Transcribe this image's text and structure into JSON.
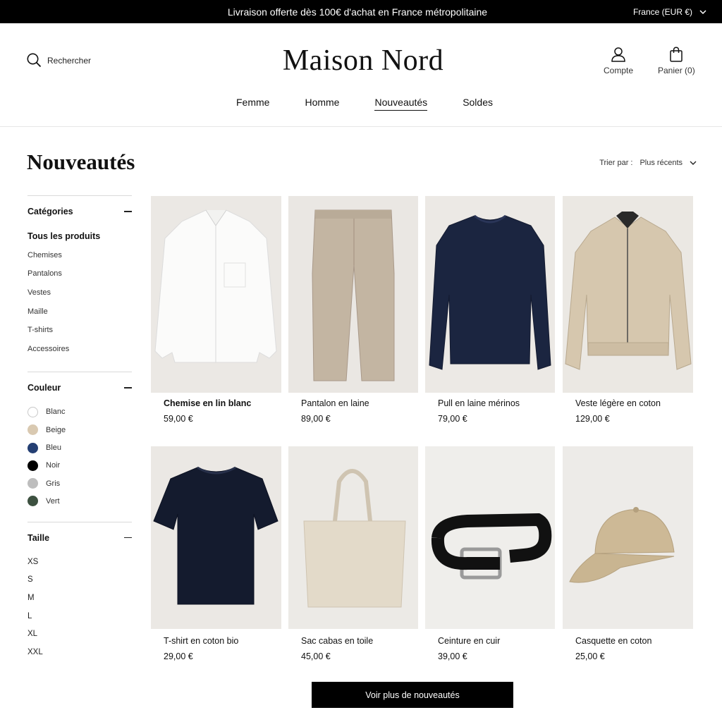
{
  "announcement": {
    "text": "Livraison offerte dès 100€ d'achat en France métropolitaine",
    "currency": "France (EUR €)"
  },
  "header": {
    "search_label": "Rechercher",
    "logo": "Maison Nord",
    "account_label": "Compte",
    "cart_label": "Panier (0)",
    "icons": {
      "search": "search-icon",
      "account": "user-icon",
      "cart": "shopping-bag-icon",
      "currency": "chevron-down-icon"
    }
  },
  "nav": {
    "items": [
      "Femme",
      "Homme",
      "Nouveautés",
      "Soldes"
    ],
    "active": "Nouveautés"
  },
  "page": {
    "title": "Nouveautés",
    "sort_label": "Trier par :",
    "sort_value": "Plus récents"
  },
  "filters": {
    "categories": {
      "title": "Catégories",
      "items": [
        "Tous les produits",
        "Chemises",
        "Pantalons",
        "Vestes",
        "Maille",
        "T-shirts",
        "Accessoires"
      ],
      "selected": "Tous les produits"
    },
    "colors": {
      "title": "Couleur",
      "items": [
        {
          "label": "Blanc",
          "hex": "#ffffff"
        },
        {
          "label": "Beige",
          "hex": "#d9c9b1"
        },
        {
          "label": "Bleu",
          "hex": "#243f73"
        },
        {
          "label": "Noir",
          "hex": "#000000"
        },
        {
          "label": "Gris",
          "hex": "#bdbdbd"
        },
        {
          "label": "Vert",
          "hex": "#3d5140"
        }
      ]
    },
    "sizes": {
      "title": "Taille",
      "items": [
        "XS",
        "S",
        "M",
        "L",
        "XL",
        "XXL"
      ]
    }
  },
  "products": [
    {
      "name": "Chemise en lin blanc",
      "price": "59,00 €",
      "image": "white-shirt"
    },
    {
      "name": "Pantalon en laine",
      "price": "89,00 €",
      "image": "beige-trousers"
    },
    {
      "name": "Pull en laine mérinos",
      "price": "79,00 €",
      "image": "navy-sweater"
    },
    {
      "name": "Veste légère en coton",
      "price": "129,00 €",
      "image": "beige-jacket"
    },
    {
      "name": "T-shirt en coton bio",
      "price": "29,00 €",
      "image": "navy-tshirt"
    },
    {
      "name": "Sac cabas en toile",
      "price": "45,00 €",
      "image": "canvas-tote"
    },
    {
      "name": "Ceinture en cuir",
      "price": "39,00 €",
      "image": "leather-belt"
    },
    {
      "name": "Casquette en coton",
      "price": "25,00 €",
      "image": "beige-cap"
    }
  ],
  "load_more": "Voir plus de nouveautés"
}
